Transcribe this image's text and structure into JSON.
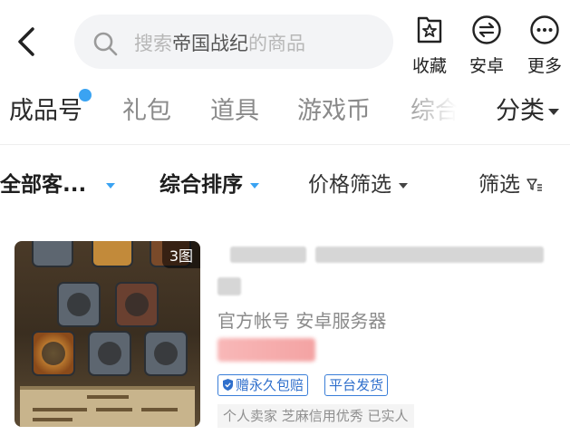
{
  "search": {
    "placeholder_pre": "搜索",
    "keyword": "帝国战纪",
    "placeholder_post": "的商品"
  },
  "actions": [
    {
      "label": "收藏",
      "icon": "favorite-star-icon"
    },
    {
      "label": "安卓",
      "icon": "android-swap-icon"
    },
    {
      "label": "更多",
      "icon": "more-dots-icon"
    }
  ],
  "tabs": [
    {
      "label": "成品号",
      "active": true,
      "has_dot": true
    },
    {
      "label": "礼包",
      "active": false
    },
    {
      "label": "道具",
      "active": false
    },
    {
      "label": "游戏币",
      "active": false
    },
    {
      "label": "综合",
      "active": false
    }
  ],
  "category": {
    "label": "分类"
  },
  "filters": {
    "all_clients": "全部客...",
    "sort": "综合排序",
    "price": "价格筛选",
    "filter": "筛选"
  },
  "listing": {
    "image_count": "3图",
    "meta": "官方帐号 安卓服务器",
    "tags": [
      "赠永久包赔",
      "平台发货"
    ],
    "seller": "个人卖家 芝麻信用优秀 已实人"
  },
  "colors": {
    "accent": "#3aa3f2",
    "tag_blue": "#2f6fcc",
    "price_pink": "#f4a3a3"
  }
}
